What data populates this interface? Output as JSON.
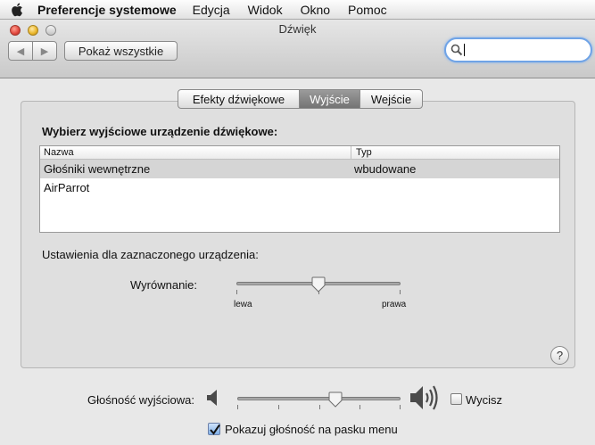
{
  "menubar": {
    "app": "Preferencje systemowe",
    "items": [
      "Edycja",
      "Widok",
      "Okno",
      "Pomoc"
    ]
  },
  "window": {
    "title": "Dźwięk",
    "show_all": "Pokaż wszystkie",
    "search_value": "",
    "search_placeholder": ""
  },
  "tabs": [
    {
      "label": "Efekty dźwiękowe",
      "selected": false
    },
    {
      "label": "Wyjście",
      "selected": true
    },
    {
      "label": "Wejście",
      "selected": false
    }
  ],
  "output": {
    "heading": "Wybierz wyjściowe urządzenie dźwiękowe:",
    "columns": [
      "Nazwa",
      "Typ"
    ],
    "rows": [
      {
        "name": "Głośniki wewnętrzne",
        "type": "wbudowane",
        "selected": true
      },
      {
        "name": "AirParrot",
        "type": "",
        "selected": false
      }
    ],
    "settings_label": "Ustawienia dla zaznaczonego urządzenia:",
    "balance": {
      "label": "Wyrównanie:",
      "min_label": "lewa",
      "max_label": "prawa",
      "value": 0.5
    },
    "help": "?"
  },
  "volume": {
    "label": "Głośność wyjściowa:",
    "value": 0.6,
    "mute_label": "Wycisz",
    "muted": false
  },
  "show_in_menu": {
    "label": "Pokazuj głośność na pasku menu",
    "checked": true
  },
  "colors": {
    "search_focus": "#6fa3e6",
    "checkbox_checked": "#7fb0e8"
  }
}
